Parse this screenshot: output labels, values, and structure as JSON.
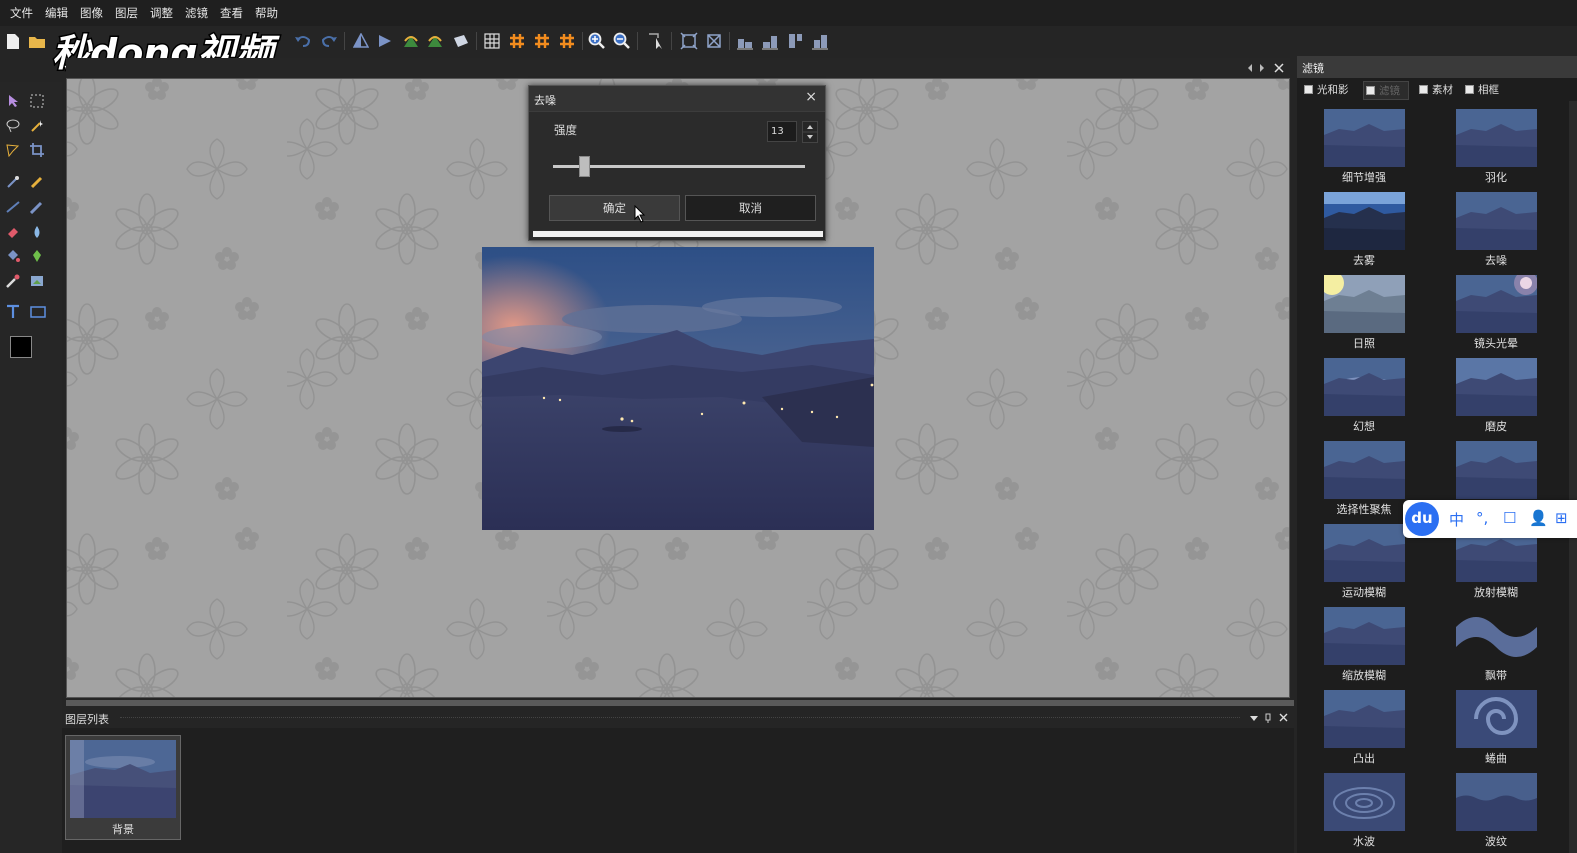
{
  "menu": [
    "文件",
    "编辑",
    "图像",
    "图层",
    "调整",
    "滤镜",
    "查看",
    "帮助"
  ],
  "watermark": "秒dong视频",
  "dialog": {
    "title": "去噪",
    "strength_label": "强度",
    "strength_value": "13",
    "ok": "确定",
    "cancel": "取消"
  },
  "layers": {
    "title": "图层列表",
    "items": [
      {
        "name": "背景"
      }
    ]
  },
  "filter_panel": {
    "title": "滤镜",
    "tabs": [
      "光和影",
      "滤镜",
      "素材",
      "相框"
    ],
    "active_tab": "滤镜",
    "filters": [
      "细节增强",
      "羽化",
      "去雾",
      "去噪",
      "日照",
      "镜头光晕",
      "幻想",
      "磨皮",
      "选择性聚焦",
      "",
      "运动模糊",
      "放射模糊",
      "缩放模糊",
      "飘带",
      "凸出",
      "蜷曲",
      "水波",
      "波纹"
    ]
  },
  "ime": {
    "logo": "du",
    "items": [
      "中",
      "°,",
      "☐",
      "👤",
      "⊞"
    ]
  },
  "colors": {
    "accent_orange": "#f28c1e",
    "ime_blue": "#2b6ff2",
    "canvas_bg": "#a3a3a3"
  }
}
